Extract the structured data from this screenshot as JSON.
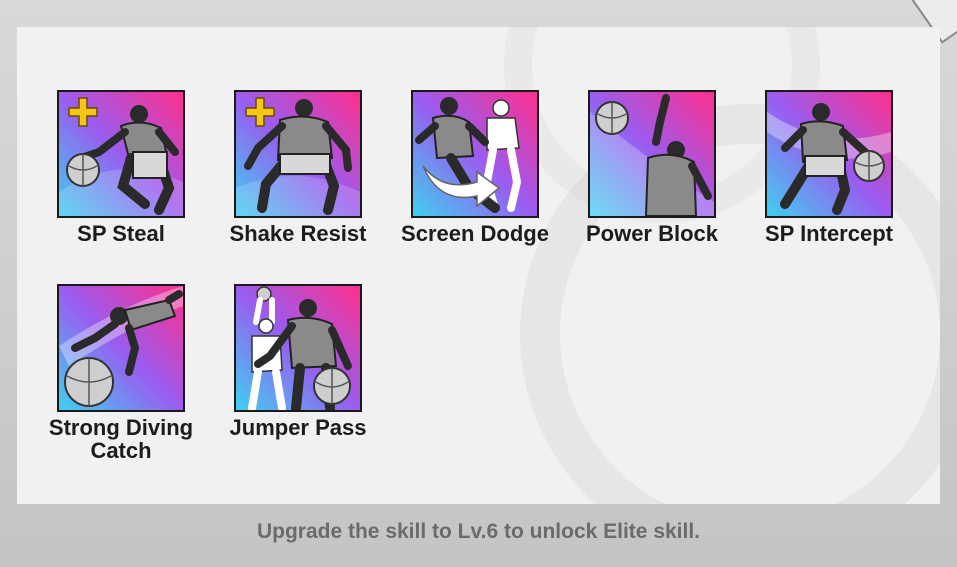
{
  "skills": [
    {
      "label": "SP Steal",
      "icon": "sp-steal-icon",
      "badge": true
    },
    {
      "label": "Shake Resist",
      "icon": "shake-resist-icon",
      "badge": true
    },
    {
      "label": "Screen Dodge",
      "icon": "screen-dodge-icon",
      "badge": false
    },
    {
      "label": "Power Block",
      "icon": "power-block-icon",
      "badge": false
    },
    {
      "label": "SP Intercept",
      "icon": "sp-intercept-icon",
      "badge": false
    },
    {
      "label": "Strong Diving Catch",
      "icon": "strong-diving-catch-icon",
      "badge": false
    },
    {
      "label": "Jumper Pass",
      "icon": "jumper-pass-icon",
      "badge": false
    }
  ],
  "footer": {
    "message": "Upgrade the skill to Lv.6 to unlock Elite skill."
  },
  "colors": {
    "gradient_start": "#3fd0f0",
    "gradient_mid": "#9a5cf0",
    "gradient_end": "#ff2f8c",
    "badge": "#f5c518"
  }
}
